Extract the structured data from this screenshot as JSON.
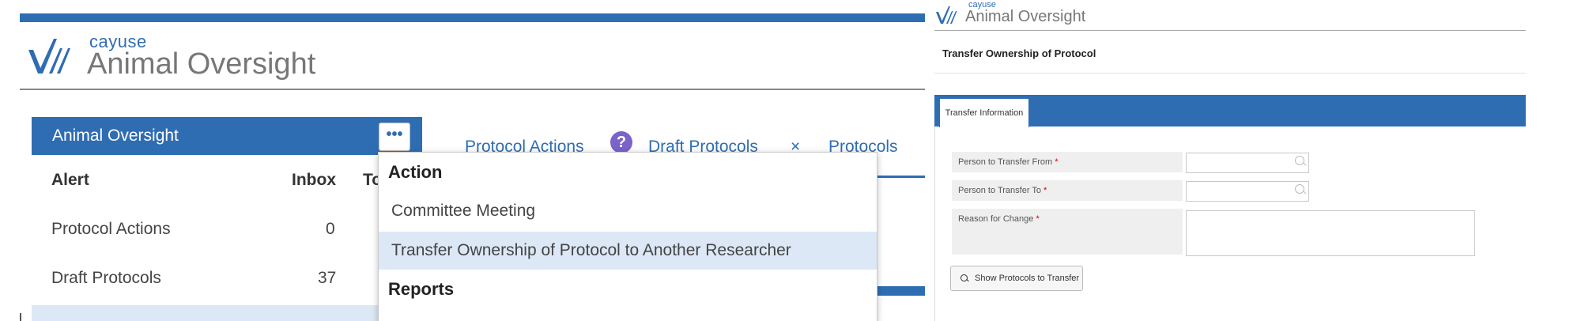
{
  "brand": {
    "company": "cayuse",
    "product": "Animal Oversight"
  },
  "left": {
    "panel_title": "Animal Oversight",
    "more_button": "•••",
    "table": {
      "headers": {
        "alert": "Alert",
        "inbox": "Inbox",
        "total": "To"
      },
      "rows": [
        {
          "alert": "Protocol Actions",
          "inbox": "0"
        },
        {
          "alert": "Draft Protocols",
          "inbox": "37"
        }
      ]
    },
    "tabs": {
      "protocol_actions": "Protocol Actions",
      "help_icon_glyph": "?",
      "draft_protocols": "Draft Protocols",
      "close_glyph": "×",
      "protocols": "Protocols"
    },
    "dropdown": {
      "action_heading": "Action",
      "items": [
        {
          "label": "Committee Meeting",
          "selected": false
        },
        {
          "label": "Transfer Ownership of Protocol to Another Researcher",
          "selected": true
        }
      ],
      "reports_heading": "Reports"
    }
  },
  "right": {
    "page_title": "Transfer Ownership of Protocol",
    "tab": "Transfer Information",
    "fields": {
      "transfer_from": {
        "label": "Person to Transfer From",
        "value": ""
      },
      "transfer_to": {
        "label": "Person to Transfer To",
        "value": ""
      },
      "reason": {
        "label": "Reason for Change",
        "value": ""
      },
      "required_marker": "*"
    },
    "show_button": "Show Protocols to Transfer"
  },
  "colors": {
    "accent": "#2f6db3",
    "selected_row": "#dce8f6",
    "help_icon": "#7a63c9",
    "required": "#d10000"
  }
}
